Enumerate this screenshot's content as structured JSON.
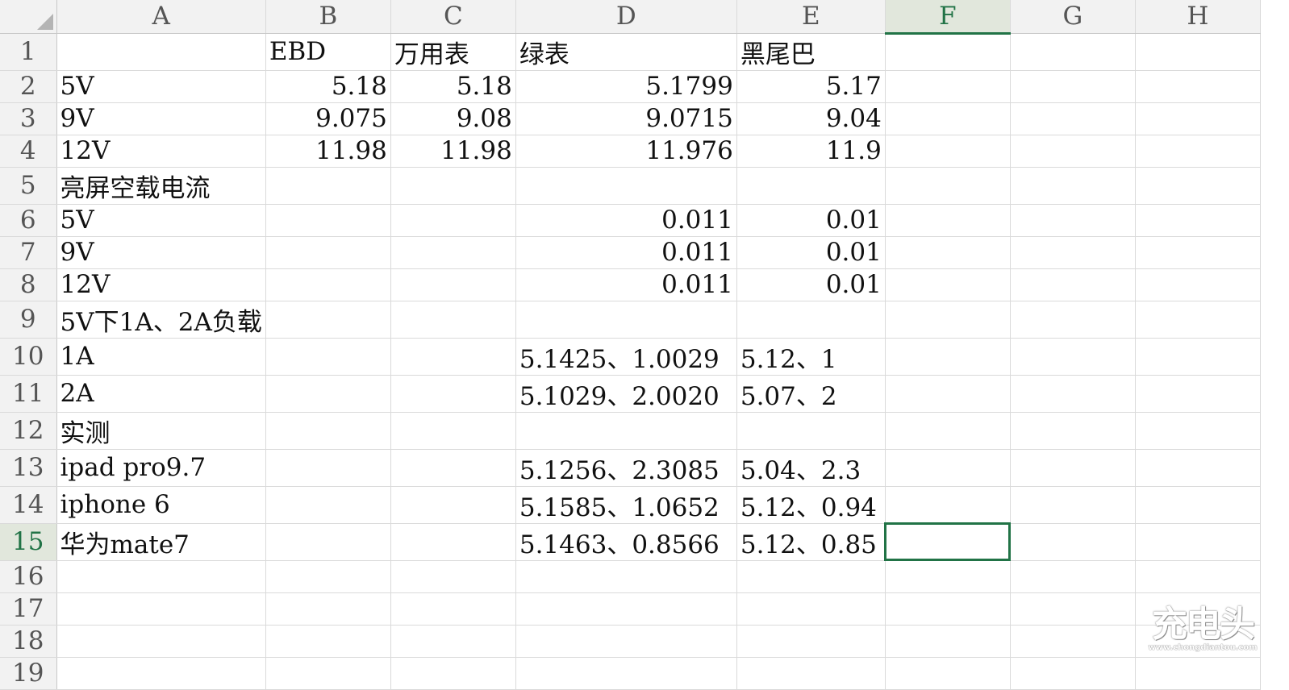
{
  "columns": [
    "A",
    "B",
    "C",
    "D",
    "E",
    "F",
    "G",
    "H"
  ],
  "selected_column": "F",
  "selected_row": "15",
  "rows": [
    {
      "num": "1",
      "cells": [
        "",
        "EBD",
        "万用表",
        "绿表",
        "黑尾巴",
        "",
        "",
        ""
      ]
    },
    {
      "num": "2",
      "cells": [
        "5V",
        "5.18",
        "5.18",
        "5.1799",
        "5.17",
        "",
        "",
        ""
      ]
    },
    {
      "num": "3",
      "cells": [
        "9V",
        "9.075",
        "9.08",
        "9.0715",
        "9.04",
        "",
        "",
        ""
      ]
    },
    {
      "num": "4",
      "cells": [
        "12V",
        "11.98",
        "11.98",
        "11.976",
        "11.9",
        "",
        "",
        ""
      ]
    },
    {
      "num": "5",
      "cells": [
        "亮屏空载电流",
        "",
        "",
        "",
        "",
        "",
        "",
        ""
      ]
    },
    {
      "num": "6",
      "cells": [
        "5V",
        "",
        "",
        "0.011",
        "0.01",
        "",
        "",
        ""
      ]
    },
    {
      "num": "7",
      "cells": [
        "9V",
        "",
        "",
        "0.011",
        "0.01",
        "",
        "",
        ""
      ]
    },
    {
      "num": "8",
      "cells": [
        "12V",
        "",
        "",
        "0.011",
        "0.01",
        "",
        "",
        ""
      ]
    },
    {
      "num": "9",
      "cells": [
        "5V下1A、2A负载",
        "",
        "",
        "",
        "",
        "",
        "",
        ""
      ]
    },
    {
      "num": "10",
      "cells": [
        "1A",
        "",
        "",
        "5.1425、1.0029",
        "5.12、1",
        "",
        "",
        ""
      ]
    },
    {
      "num": "11",
      "cells": [
        "2A",
        "",
        "",
        "5.1029、2.0020",
        "5.07、2",
        "",
        "",
        ""
      ]
    },
    {
      "num": "12",
      "cells": [
        "实测",
        "",
        "",
        "",
        "",
        "",
        "",
        ""
      ]
    },
    {
      "num": "13",
      "cells": [
        "ipad pro9.7",
        "",
        "",
        "5.1256、2.3085",
        "5.04、2.3",
        "",
        "",
        ""
      ]
    },
    {
      "num": "14",
      "cells": [
        "iphone 6",
        "",
        "",
        "5.1585、1.0652",
        "5.12、0.94",
        "",
        "",
        ""
      ]
    },
    {
      "num": "15",
      "cells": [
        "华为mate7",
        "",
        "",
        "5.1463、0.8566",
        "5.12、0.85",
        "",
        "",
        ""
      ]
    },
    {
      "num": "16",
      "cells": [
        "",
        "",
        "",
        "",
        "",
        "",
        "",
        ""
      ]
    },
    {
      "num": "17",
      "cells": [
        "",
        "",
        "",
        "",
        "",
        "",
        "",
        ""
      ]
    },
    {
      "num": "18",
      "cells": [
        "",
        "",
        "",
        "",
        "",
        "",
        "",
        ""
      ]
    },
    {
      "num": "19",
      "cells": [
        "",
        "",
        "",
        "",
        "",
        "",
        "",
        ""
      ]
    }
  ],
  "watermark": {
    "main": "充电头",
    "sub": "www.chongdiantou.com"
  }
}
